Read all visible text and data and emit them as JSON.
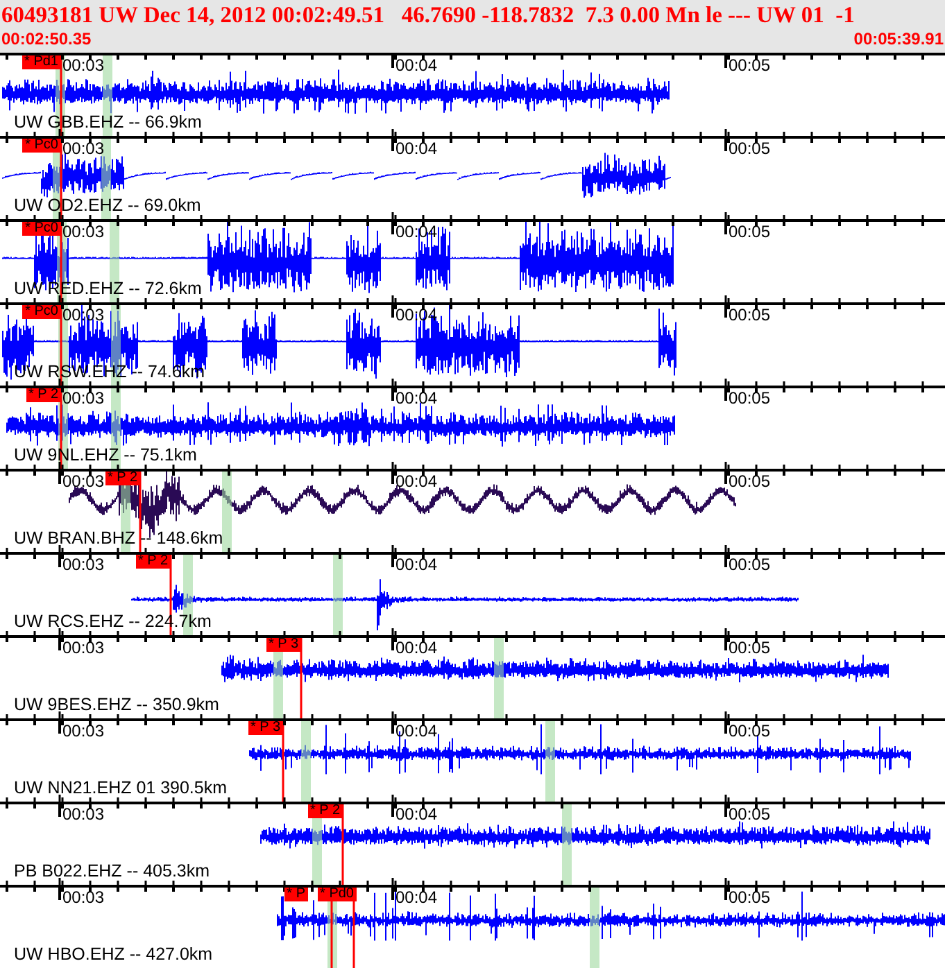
{
  "header": {
    "title": "60493181 UW Dec 14, 2012 00:02:49.51   46.7690 -118.7832  7.3 0.00 Mn le --- UW 01  -1",
    "start_time": "00:02:50.35",
    "end_time": "00:05:39.91"
  },
  "traces": [
    {
      "label": "UW GBB.EHZ -- 66.9km",
      "color": "#0000ff",
      "time_labels": [
        "00:03",
        "00:04",
        "00:05"
      ],
      "picks": [
        "* Pd1"
      ]
    },
    {
      "label": "UW OD2.EHZ -- 69.0km",
      "color": "#0000ff",
      "time_labels": [
        "00:03",
        "00:04",
        "00:05"
      ],
      "picks": [
        "* Pc0"
      ]
    },
    {
      "label": "UW RED.EHZ -- 72.6km",
      "color": "#0000ff",
      "time_labels": [
        "00:03",
        "00:04",
        "00:05"
      ],
      "picks": [
        "* Pc0"
      ]
    },
    {
      "label": "UW RSW.EHZ -- 74.6km",
      "color": "#0000ff",
      "time_labels": [
        "00:03",
        "00:04",
        "00:05"
      ],
      "picks": [
        "* Pc0"
      ]
    },
    {
      "label": "UW 9NL.EHZ -- 75.1km",
      "color": "#0000ff",
      "time_labels": [
        "00:03",
        "00:04",
        "00:05"
      ],
      "picks": [
        "* P 2"
      ]
    },
    {
      "label": "UW BRAN.BHZ -- 148.6km",
      "color": "#2a0a55",
      "time_labels": [
        "00:03",
        "00:04",
        "00:05"
      ],
      "picks": [
        "* P 2"
      ]
    },
    {
      "label": "UW RCS.EHZ -- 224.7km",
      "color": "#0000ff",
      "time_labels": [
        "00:03",
        "00:04",
        "00:05"
      ],
      "picks": [
        "* P 2"
      ]
    },
    {
      "label": "UW 9BES.EHZ -- 350.9km",
      "color": "#0000ff",
      "time_labels": [
        "00:03",
        "00:04",
        "00:05"
      ],
      "picks": [
        "* P 3"
      ]
    },
    {
      "label": "UW NN21.EHZ 01 390.5km",
      "color": "#0000ff",
      "time_labels": [
        "00:03",
        "00:04",
        "00:05"
      ],
      "picks": [
        "* P 3"
      ]
    },
    {
      "label": "PB B022.EHZ -- 405.3km",
      "color": "#0000ff",
      "time_labels": [
        "00:03",
        "00:04",
        "00:05"
      ],
      "picks": [
        "* P 2"
      ]
    },
    {
      "label": "UW HBO.EHZ -- 427.0km",
      "color": "#0000ff",
      "time_labels": [
        "00:03",
        "00:04",
        "00:05"
      ],
      "picks": [
        "* P",
        "* Pd0"
      ]
    }
  ]
}
